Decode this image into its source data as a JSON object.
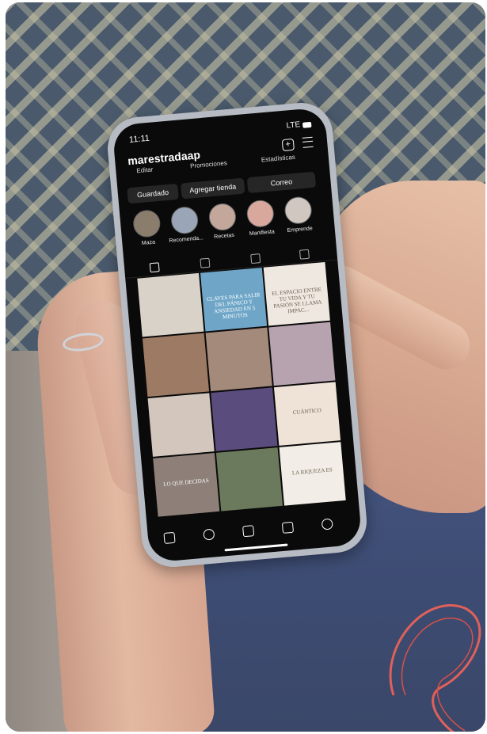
{
  "status": {
    "time": "11:11",
    "network": "LTE"
  },
  "profile": {
    "handle": "marestradaap"
  },
  "top_tabs": [
    "Editar",
    "Promociones",
    "Estadísticas"
  ],
  "action_buttons": [
    "Guardado",
    "Agregar tienda",
    "Correo"
  ],
  "highlights": [
    {
      "label": "Maza"
    },
    {
      "label": "Recomenda..."
    },
    {
      "label": "Recetas"
    },
    {
      "label": "Manifiesta"
    },
    {
      "label": "Emprende"
    }
  ],
  "grid_tabs": [
    "grid-icon",
    "reels-icon",
    "shop-icon",
    "tagged-icon"
  ],
  "posts": [
    {
      "color": "#d9d2c8",
      "text": ""
    },
    {
      "color": "#6fa6c8",
      "text": "CLAVES PARA SALIR DEL PÁNICO Y ANSIEDAD EN 5 MINUTOS"
    },
    {
      "color": "#efe8e0",
      "text": "EL ESPACIO ENTRE TU VIDA Y TU PASIÓN SE LLAMA IMPAC..."
    },
    {
      "color": "#9c7a63",
      "text": ""
    },
    {
      "color": "#a48a7a",
      "text": ""
    },
    {
      "color": "#b7a3b0",
      "text": ""
    },
    {
      "color": "#d3c7bd",
      "text": ""
    },
    {
      "color": "#5b4c7e",
      "text": ""
    },
    {
      "color": "#efe3d8",
      "text": "CUÁNTICO"
    },
    {
      "color": "#8e8078",
      "text": "LO QUE DECIDAS"
    },
    {
      "color": "#6b7a5c",
      "text": ""
    },
    {
      "color": "#f2ede6",
      "text": "LA RIQUEZA ES"
    }
  ],
  "bottom_nav": [
    "home-icon",
    "search-icon",
    "reels-icon",
    "shop-icon",
    "profile-icon"
  ]
}
